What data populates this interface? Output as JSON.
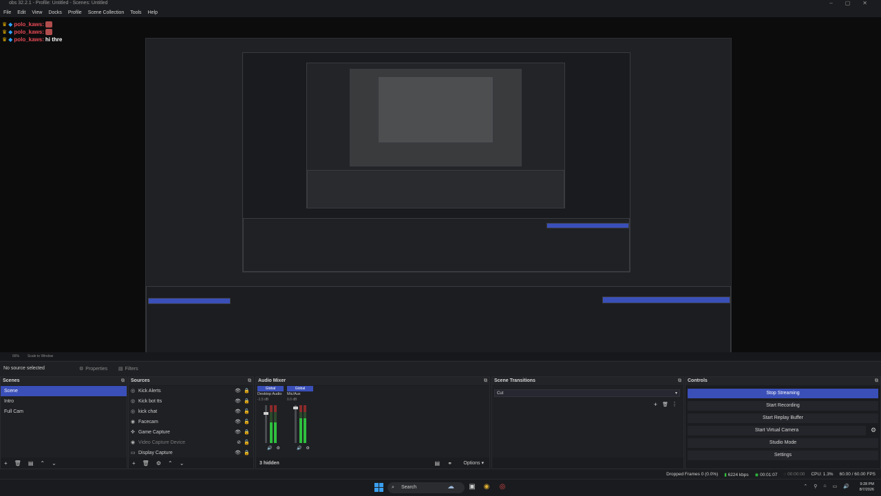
{
  "window": {
    "title": "obs 32.2.1 - Profile: Untitled - Scenes: Untitled",
    "controls": [
      "–",
      "▢",
      "✕"
    ]
  },
  "menu": [
    "File",
    "Edit",
    "View",
    "Docks",
    "Profile",
    "Scene Collection",
    "Tools",
    "Help"
  ],
  "chat": [
    {
      "user": "polo_kaws:",
      "msg": ""
    },
    {
      "user": "polo_kaws:",
      "msg": ""
    },
    {
      "user": "polo_kaws:",
      "msg": "hi thre"
    }
  ],
  "preview_bar": {
    "zoom": "66%",
    "scale": "Scale to Window"
  },
  "context": {
    "no_source": "No source selected",
    "properties": "Properties",
    "filters": "Filters"
  },
  "docks": {
    "scenes": {
      "title": "Scenes",
      "items": [
        "Scene",
        "Intro",
        "Full Cam"
      ],
      "selected": 0
    },
    "sources": {
      "title": "Sources",
      "items": [
        {
          "name": "Kick Alerts",
          "icon": "browser-icon",
          "dim": false
        },
        {
          "name": "Kick bot tts",
          "icon": "browser-icon",
          "dim": false
        },
        {
          "name": "kick chat",
          "icon": "browser-icon",
          "dim": false
        },
        {
          "name": "Facecam",
          "icon": "camera-icon",
          "dim": false
        },
        {
          "name": "Game Capture",
          "icon": "gamepad-icon",
          "dim": false
        },
        {
          "name": "Video Capture Device",
          "icon": "camera-icon",
          "dim": true
        },
        {
          "name": "Display Capture",
          "icon": "monitor-icon",
          "dim": false
        }
      ]
    },
    "mixer": {
      "title": "Audio Mixer",
      "channels": [
        {
          "head": "Global",
          "name": "Desktop Audio",
          "db": "-1.5 dB",
          "level": 0.55
        },
        {
          "head": "Global",
          "name": "Mic/Aux",
          "db": "0.0 dB",
          "level": 0.65
        }
      ],
      "hidden": "3 hidden",
      "options": "Options"
    },
    "transitions": {
      "title": "Scene Transitions",
      "selected": "Cut"
    },
    "controls": {
      "title": "Controls",
      "buttons": [
        "Stop Streaming",
        "Start Recording",
        "Start Replay Buffer",
        "Start Virtual Camera",
        "Studio Mode",
        "Settings"
      ]
    }
  },
  "status": {
    "dropped": "Dropped Frames 0 (0.0%)",
    "kbps": "6224 kbps",
    "stream_time": "00:01:07",
    "rec_time": "00:00:00",
    "cpu": "CPU: 1.3%",
    "fps": "60.00 / 60.00 FPS"
  },
  "taskbar": {
    "search": "Search",
    "time": "9:28 PM",
    "date": "8/7/2026"
  },
  "colors": {
    "accent": "#3a4fb8",
    "meter_green": "#2fbf3f",
    "chat_user": "#e84b55"
  }
}
